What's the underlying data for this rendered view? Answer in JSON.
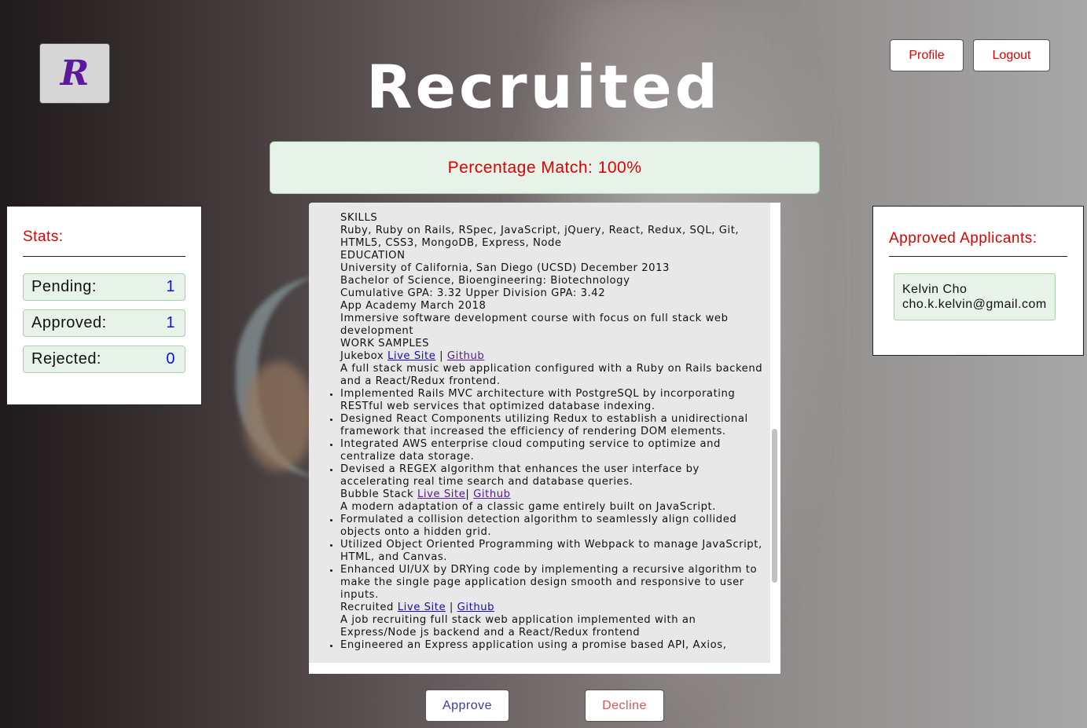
{
  "header": {
    "logo_letter": "R",
    "title": "Recruited",
    "profile_label": "Profile",
    "logout_label": "Logout"
  },
  "match": {
    "text": "Percentage Match: 100%"
  },
  "stats": {
    "title": "Stats:",
    "rows": [
      {
        "label": "Pending:",
        "value": "1"
      },
      {
        "label": "Approved:",
        "value": "1"
      },
      {
        "label": "Rejected:",
        "value": "0"
      }
    ]
  },
  "approved": {
    "title": "Approved Applicants:",
    "applicants": [
      {
        "name": "Kelvin Cho",
        "email": "cho.k.kelvin@gmail.com"
      }
    ]
  },
  "resume": {
    "skills_heading": "SKILLS",
    "skills_text": "Ruby, Ruby on Rails, RSpec, JavaScript, jQuery, React, Redux, SQL, Git, HTML5, CSS3, MongoDB, Express, Node",
    "education_heading": "EDUCATION",
    "education_lines": [
      "University of California, San Diego (UCSD) December 2013",
      "Bachelor of Science, Bioengineering: Biotechnology",
      "Cumulative GPA: 3.32 Upper Division GPA: 3.42",
      "App Academy March 2018",
      "Immersive software development course with focus on full stack web development"
    ],
    "work_heading": "WORK SAMPLES",
    "projects": [
      {
        "name": "Jukebox ",
        "live_label": "Live Site",
        "sep": " | ",
        "github_label": "Github",
        "description": "A full stack music web application configured with a Ruby on Rails backend and a React/Redux frontend.",
        "bullets": [
          "Implemented Rails MVC architecture with PostgreSQL by incorporating RESTful web services that optimized database indexing.",
          "Designed React Components utilizing Redux to establish a unidirectional framework that increased the efficiency of rendering DOM elements.",
          "Integrated AWS enterprise cloud computing service to optimize and centralize data storage.",
          "Devised a REGEX algorithm that enhances the user interface by accelerating real time search and database queries."
        ]
      },
      {
        "name": "Bubble Stack ",
        "live_label": "Live Site",
        "sep": "| ",
        "github_label": "Github",
        "description": "A modern adaptation of a classic game entirely built on JavaScript.",
        "bullets": [
          "Formulated a collision detection algorithm to seamlessly align collided objects onto a hidden grid.",
          "Utilized Object Oriented Programming with Webpack to manage JavaScript, HTML, and Canvas.",
          "Enhanced UI/UX by DRYing code by implementing a recursive algorithm to make the single page application design smooth and responsive to user inputs."
        ]
      },
      {
        "name": "Recruited ",
        "live_label": "Live Site",
        "sep": " | ",
        "github_label": "Github",
        "description": "A job recruiting full stack web application implemented with an Express/Node js backend and a React/Redux frontend",
        "bullets": [
          "Engineered an Express application using a promise based API, Axios,"
        ]
      }
    ]
  },
  "actions": {
    "approve_label": "Approve",
    "decline_label": "Decline"
  }
}
